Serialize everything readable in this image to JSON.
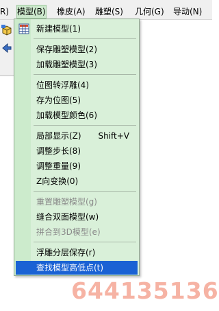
{
  "menubar": {
    "items": [
      {
        "label": "R)"
      },
      {
        "label": "模型(B)"
      },
      {
        "label": "橡皮(A)"
      },
      {
        "label": "雕塑(S)"
      },
      {
        "label": "几何(G)"
      },
      {
        "label": "导动(N)"
      }
    ]
  },
  "menu": {
    "items": [
      {
        "label": "新建模型(1)",
        "icon": "grid-icon"
      },
      {
        "label": "保存雕塑模型(2)"
      },
      {
        "label": "加载雕塑模型(3)"
      },
      {
        "label": "位图转浮雕(4)"
      },
      {
        "label": "存为位图(5)"
      },
      {
        "label": "加载模型颜色(6)"
      },
      {
        "label": "局部显示(Z)",
        "shortcut": "Shift+V"
      },
      {
        "label": "调整步长(8)"
      },
      {
        "label": "调整重量(9)"
      },
      {
        "label": "Z向变换(0)"
      },
      {
        "label": "重置雕塑模型(g)",
        "disabled": true
      },
      {
        "label": "缝合双面模型(w)"
      },
      {
        "label": "拼合到3D模型(e)",
        "disabled": true
      },
      {
        "label": "浮雕分层保存(r)"
      },
      {
        "label": "查找模型高低点(t)",
        "selected": true
      }
    ]
  },
  "watermark": "644135136",
  "colors": {
    "menu_bg": "#d9f0d9",
    "selected_bg": "#1a62d4",
    "watermark": "#f6b3a4"
  }
}
